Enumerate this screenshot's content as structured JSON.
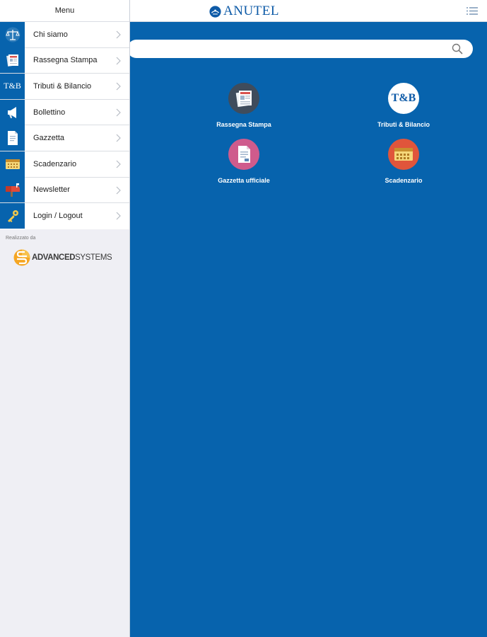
{
  "header": {
    "brand": "ANUTEL"
  },
  "drawer": {
    "title": "Menu",
    "items": [
      {
        "label": "Chi siamo",
        "icon": "scales-icon"
      },
      {
        "label": "Rassegna Stampa",
        "icon": "newspaper-icon"
      },
      {
        "label": "Tributi & Bilancio",
        "icon": "tb-icon",
        "icon_text": "T&B"
      },
      {
        "label": "Bollettino",
        "icon": "megaphone-icon"
      },
      {
        "label": "Gazzetta",
        "icon": "document-icon"
      },
      {
        "label": "Scadenzario",
        "icon": "calendar-icon"
      },
      {
        "label": "Newsletter",
        "icon": "mailbox-icon"
      },
      {
        "label": "Login / Logout",
        "icon": "key-icon"
      }
    ],
    "credit_label": "Realizzato da",
    "credit_brand_bold": "ADVANCED",
    "credit_brand_light": "SYSTEMS"
  },
  "tiles": [
    {
      "label": "Rassegna Stampa",
      "icon": "newspaper-icon",
      "color": "#3f4c5c"
    },
    {
      "label": "Tributi & Bilancio",
      "icon": "tb-icon",
      "icon_text": "T&B",
      "color": "#ffffff"
    },
    {
      "label": "Gazzetta ufficiale",
      "icon": "document-icon",
      "color": "#cf5b8c"
    },
    {
      "label": "Scadenzario",
      "icon": "calendar-icon",
      "color": "#e0553b"
    }
  ],
  "colors": {
    "primary": "#0763ad",
    "drawer_bg": "#efeff4",
    "brand": "#0d5aa7"
  }
}
